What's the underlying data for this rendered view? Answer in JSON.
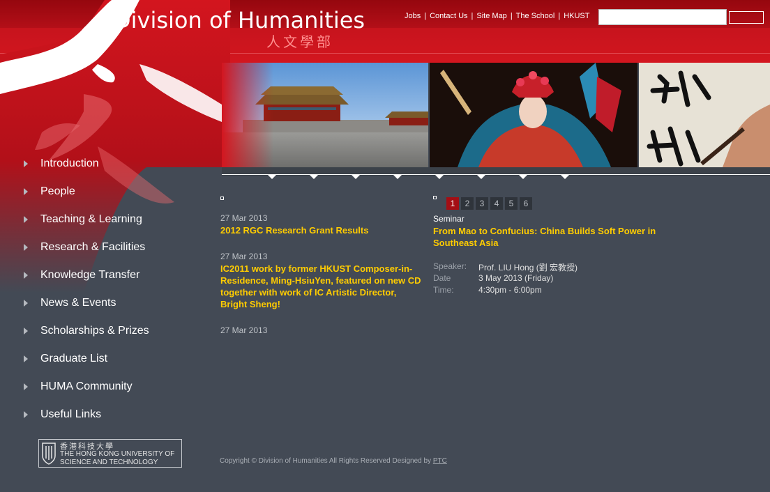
{
  "header": {
    "title": "Division of Humanities",
    "subtitle": "人文學部",
    "links": [
      "Jobs",
      "Contact Us",
      "Site Map",
      "The School",
      "HKUST"
    ],
    "search_placeholder": "",
    "search_button_label": ""
  },
  "nav": {
    "items": [
      "Introduction",
      "People",
      "Teaching & Learning",
      "Research & Facilities",
      "Knowledge Transfer",
      "News & Events",
      "Scholarships & Prizes",
      "Graduate List",
      "HUMA Community",
      "Useful Links"
    ]
  },
  "logo": {
    "cn": "香港科技大學",
    "en_line1": "THE HONG KONG UNIVERSITY OF",
    "en_line2": "SCIENCE AND TECHNOLOGY"
  },
  "news": [
    {
      "date": "27 Mar 2013",
      "title": "2012 RGC Research Grant Results"
    },
    {
      "date": "27 Mar 2013",
      "title": "IC2011 work by former HKUST Composer-in-Residence, Ming-HsiuYen, featured on new CD together with work of IC Artistic Director, Bright Sheng!"
    },
    {
      "date": "27 Mar 2013",
      "title": ""
    }
  ],
  "events": {
    "pages": [
      "1",
      "2",
      "3",
      "4",
      "5",
      "6"
    ],
    "active_page": "1",
    "type": "Seminar",
    "title": "From Mao to Confucius: China Builds Soft Power in Southeast Asia",
    "speaker_label": "Speaker:",
    "speaker": "Prof. LIU Hong (劉 宏教授)",
    "date_label": "Date",
    "date": "3 May 2013 (Friday)",
    "time_label": "Time:",
    "time": "4:30pm - 6:00pm"
  },
  "footer": {
    "copyright": "Copyright © Division of Humanities All Rights Reserved Designed by",
    "designer": "PTC"
  },
  "colors": {
    "header_red": "#c7141d",
    "body_bg": "#434a55",
    "headline_yellow": "#ffcc00",
    "active_page": "#a40e14"
  }
}
